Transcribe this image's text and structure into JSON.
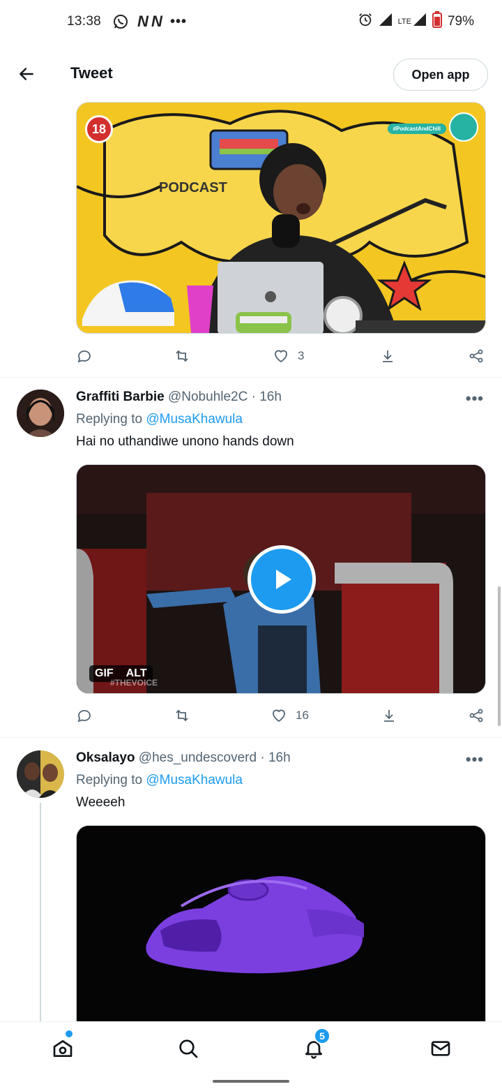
{
  "status_bar": {
    "time": "13:38",
    "notif_letters": "N N",
    "more_dots": "•••",
    "network": "LTE",
    "battery": "79%"
  },
  "header": {
    "title": "Tweet",
    "open_app_label": "Open app"
  },
  "tweet_top": {
    "media_badge": "18",
    "media_tag": "#PodcastAndChill",
    "media_text": "PODCAST",
    "stats": {
      "like_count": "3"
    }
  },
  "replies": [
    {
      "name": "Graffiti Barbie",
      "handle": "@Nobuhle2C",
      "time": "· 16h",
      "replying_prefix": "Replying to",
      "replying_handle": "@MusaKhawula",
      "text": "Hai no uthandiwe unono hands down",
      "media_badges": {
        "gif": "GIF",
        "alt": "ALT"
      },
      "media_watermark": "#THEVOICE",
      "like_count": "16"
    },
    {
      "name": "Oksalayo",
      "handle": "@hes_undescoverd",
      "time": "· 16h",
      "replying_prefix": "Replying to",
      "replying_handle": "@MusaKhawula",
      "text": "Weeeeh"
    }
  ],
  "more_label": "•••",
  "bottom_nav": {
    "notifications_count": "5"
  },
  "colors": {
    "accent": "#1d9bf0",
    "muted": "#536471",
    "text": "#0f1419",
    "border": "#cfd9de"
  }
}
